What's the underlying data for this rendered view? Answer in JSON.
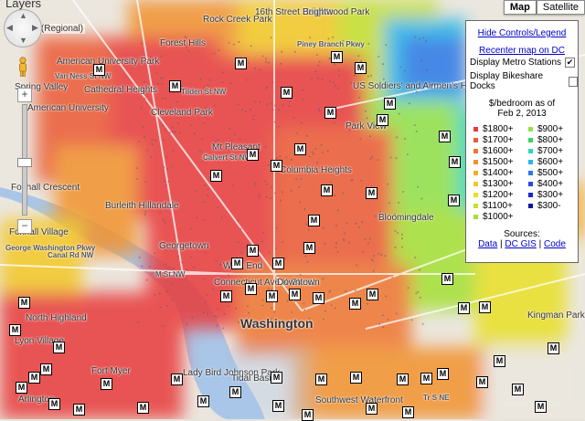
{
  "map": {
    "layers_title": "Layers",
    "layers_sub": "Stations (Regional)",
    "map_type": [
      "Map",
      "Satellite"
    ],
    "map_type_selected": "Map"
  },
  "panel": {
    "hide_link": "Hide Controls/Legend",
    "recenter_link": "Recenter map on DC",
    "metro_label": "Display Metro Stations",
    "metro_checked": "✔",
    "bikeshare_label": "Display Bikeshare Docks",
    "legend_title_1": "$/bedroom as of",
    "legend_title_2": "Feb 2, 2013",
    "legend_items": [
      {
        "label": "$1800+",
        "color": "#e83a3a"
      },
      {
        "label": "$900+",
        "color": "#90e24a"
      },
      {
        "label": "$1700+",
        "color": "#ec5a36"
      },
      {
        "label": "$800+",
        "color": "#3ad45a"
      },
      {
        "label": "$1600+",
        "color": "#ef7632"
      },
      {
        "label": "$700+",
        "color": "#2ad8b8"
      },
      {
        "label": "$1500+",
        "color": "#f2922e"
      },
      {
        "label": "$600+",
        "color": "#28b8e8"
      },
      {
        "label": "$1400+",
        "color": "#f4ac2a"
      },
      {
        "label": "$500+",
        "color": "#2a78e8"
      },
      {
        "label": "$1300+",
        "color": "#f4c828"
      },
      {
        "label": "$400+",
        "color": "#2a48e8"
      },
      {
        "label": "$1200+",
        "color": "#e8e028"
      },
      {
        "label": "$300+",
        "color": "#1a28c8"
      },
      {
        "label": "$1100+",
        "color": "#c4e02a"
      },
      {
        "label": "$300-",
        "color": "#0a1898"
      },
      {
        "label": "$1000+",
        "color": "#a4e034"
      }
    ],
    "sources_label": "Sources:",
    "source_links": [
      "Data",
      "DC GIS",
      "Code"
    ],
    "source_sep": "|"
  },
  "labels": [
    "Rock Creek Park",
    "16th Street Heights",
    "Brightwood Park",
    "Forest Hills",
    "American University Park",
    "Spring Valley",
    "Cathedral Heights",
    "Cleveland Park",
    "American University",
    "Van Ness St NW",
    "Tilden St NW",
    "Mt Pleasant",
    "Columbia Heights",
    "Park View",
    "US Soldiers' and Airmen's Home",
    "Foxhall Crescent",
    "Burleith Hillandale",
    "Georgetown",
    "Foxhall Village",
    "West End",
    "Connecticut Ave K Street",
    "Downtown",
    "Washington",
    "North Highland",
    "Lyon Village",
    "Fort Myer",
    "Lady Bird Johnson Park",
    "Tidal Basin",
    "Southwest Waterfront",
    "Bloomingdale",
    "Kingman Park",
    "Calvert St NW",
    "M St NW",
    "Canal Rd NW",
    "George Washington Pkwy",
    "Piney Branch Pkwy",
    "Arlington",
    "Tr S NE"
  ],
  "metro_count": 61
}
